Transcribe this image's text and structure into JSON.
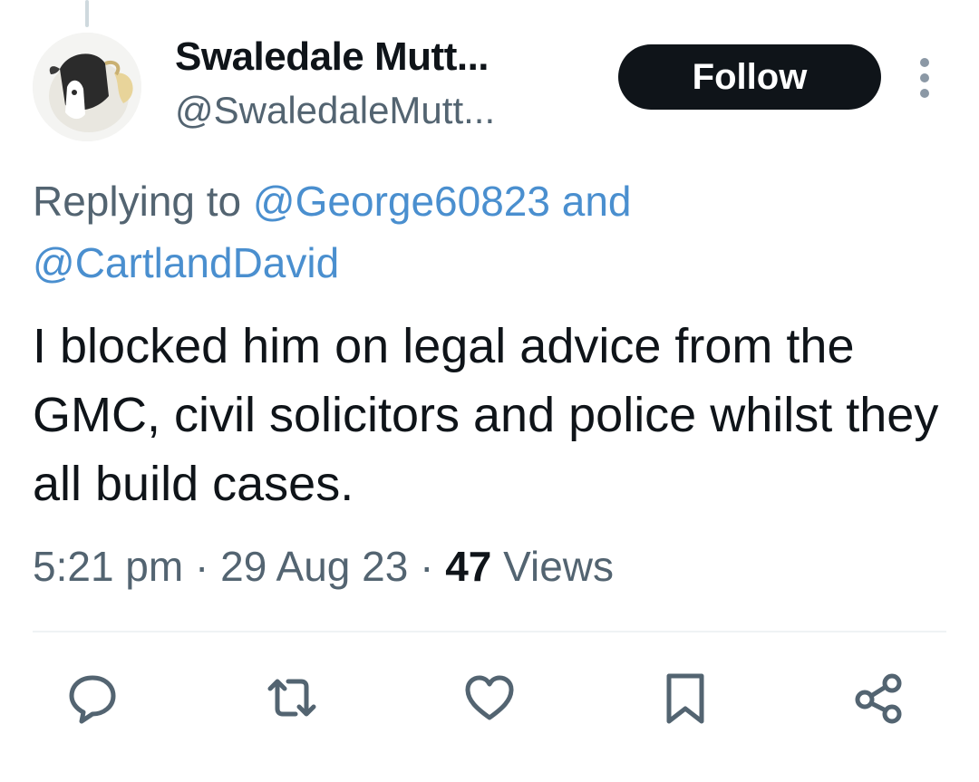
{
  "tweet": {
    "author": {
      "display_name": "Swaledale Mutt...",
      "handle": "@SwaledaleMutt..."
    },
    "follow_label": "Follow",
    "reply_context": {
      "prefix": "Replying to ",
      "mention_1": "@George60823",
      "conjunction": " and",
      "mention_2": "@CartlandDavid"
    },
    "text": "I blocked him on legal advice from the GMC, civil solicitors and police whilst they all build cases.",
    "meta": {
      "time": "5:21 pm",
      "separator_1": " · ",
      "date": "29 Aug 23",
      "separator_2": " · ",
      "views_count": "47",
      "views_label": " Views"
    }
  },
  "actions": [
    {
      "name": "reply",
      "icon": "speech-bubble-icon"
    },
    {
      "name": "retweet",
      "icon": "retweet-icon"
    },
    {
      "name": "like",
      "icon": "heart-icon"
    },
    {
      "name": "bookmark",
      "icon": "bookmark-icon"
    },
    {
      "name": "share",
      "icon": "share-icon"
    }
  ],
  "colors": {
    "text_primary": "#0f1419",
    "text_secondary": "#536471",
    "mention": "#4a8fcf",
    "button_bg": "#0f1419",
    "icon": "#536471"
  }
}
